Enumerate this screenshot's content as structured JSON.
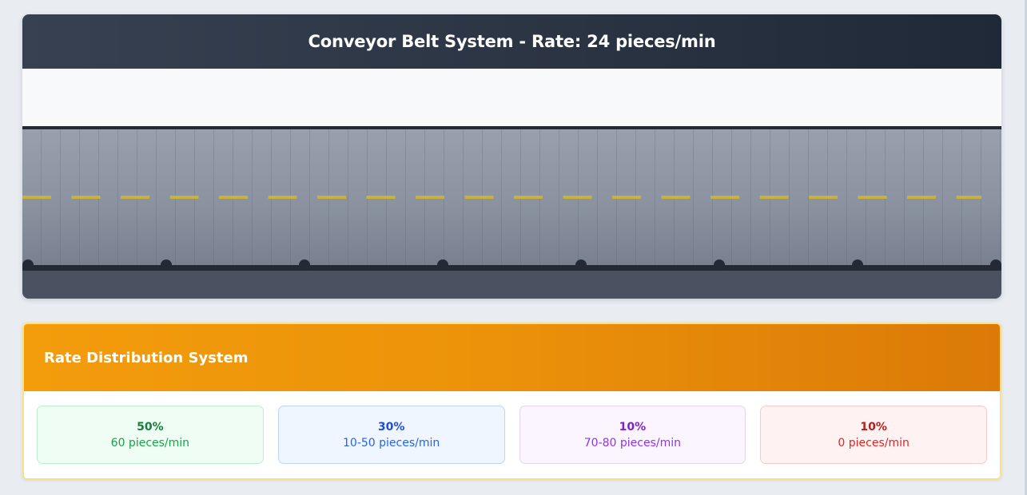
{
  "conveyor": {
    "title": "Conveyor Belt System - Rate: 24 pieces/min",
    "colors": {
      "header": "#1f2937",
      "belt": "#8b92a0",
      "dash": "#c9b23c"
    }
  },
  "distribution": {
    "title": "Rate Distribution System",
    "accent": "#f39c0c",
    "rates": [
      {
        "percent": "50%",
        "value": "60 pieces/min",
        "color": "#15803d"
      },
      {
        "percent": "30%",
        "value": "10-50 pieces/min",
        "color": "#1d4ed8"
      },
      {
        "percent": "10%",
        "value": "70-80 pieces/min",
        "color": "#7e22ce"
      },
      {
        "percent": "10%",
        "value": "0 pieces/min",
        "color": "#b91c1c"
      }
    ]
  }
}
